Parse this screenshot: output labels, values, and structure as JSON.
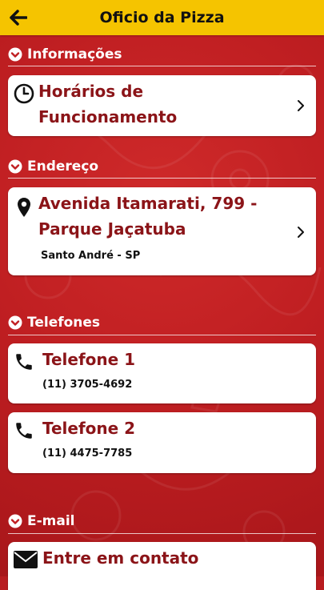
{
  "header": {
    "title": "Oficio da Pizza",
    "back_icon": "arrow-left-icon"
  },
  "colors": {
    "header_bg": "#f5c400",
    "background": "#c01f22",
    "title_text": "#8b1418",
    "card_bg": "#ffffff"
  },
  "sections": {
    "info": {
      "label": "Informações"
    },
    "address": {
      "label": "Endereço"
    },
    "phones": {
      "label": "Telefones"
    },
    "email": {
      "label": "E-mail"
    }
  },
  "hours_card": {
    "line1": "Horários de",
    "line2": "Funcionamento",
    "icon": "clock-icon"
  },
  "address_card": {
    "line1": "Avenida Itamarati, 799 -",
    "line2": "Parque Jaçatuba",
    "city": "Santo André - SP",
    "icon": "location-pin-icon"
  },
  "phone1": {
    "title": "Telefone 1",
    "number": "(11) 3705-4692",
    "icon": "phone-icon"
  },
  "phone2": {
    "title": "Telefone 2",
    "number": "(11) 4475-7785",
    "icon": "phone-icon"
  },
  "email_card": {
    "title": "Entre em contato",
    "icon": "envelope-icon"
  }
}
